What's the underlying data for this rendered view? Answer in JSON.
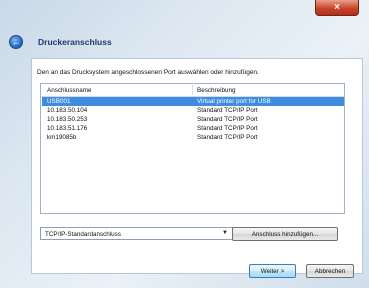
{
  "window": {
    "close_glyph": "×"
  },
  "header": {
    "back_glyph": "←",
    "title": "Druckeranschluss"
  },
  "main": {
    "instruction": "Den an das Drucksystem angeschlossenen Port auswählen oder hinzufügen.",
    "port_list": {
      "columns": [
        "Anschlussname",
        "Beschreibung"
      ],
      "rows": [
        {
          "name": "USB001",
          "description": "Virtual printer port for USB",
          "selected": true
        },
        {
          "name": "10.183.50.104",
          "description": "Standard TCP/IP Port",
          "selected": false
        },
        {
          "name": "10.183.50.253",
          "description": "Standard TCP/IP Port",
          "selected": false
        },
        {
          "name": "10.183.51.176",
          "description": "Standard TCP/IP Port",
          "selected": false
        },
        {
          "name": "km19085b",
          "description": "Standard TCP/IP Port",
          "selected": false
        }
      ]
    },
    "port_type": {
      "value": "TCP/IP-Standardanschluss",
      "arrow": "▼"
    },
    "add_port_label": "Anschluss hinzufügen..."
  },
  "footer": {
    "next_label": "Weiter >",
    "cancel_label": "Abbrechen"
  },
  "colors": {
    "selection": "#3f8be0",
    "title": "#1e3a6e",
    "close": "#c8452b"
  }
}
